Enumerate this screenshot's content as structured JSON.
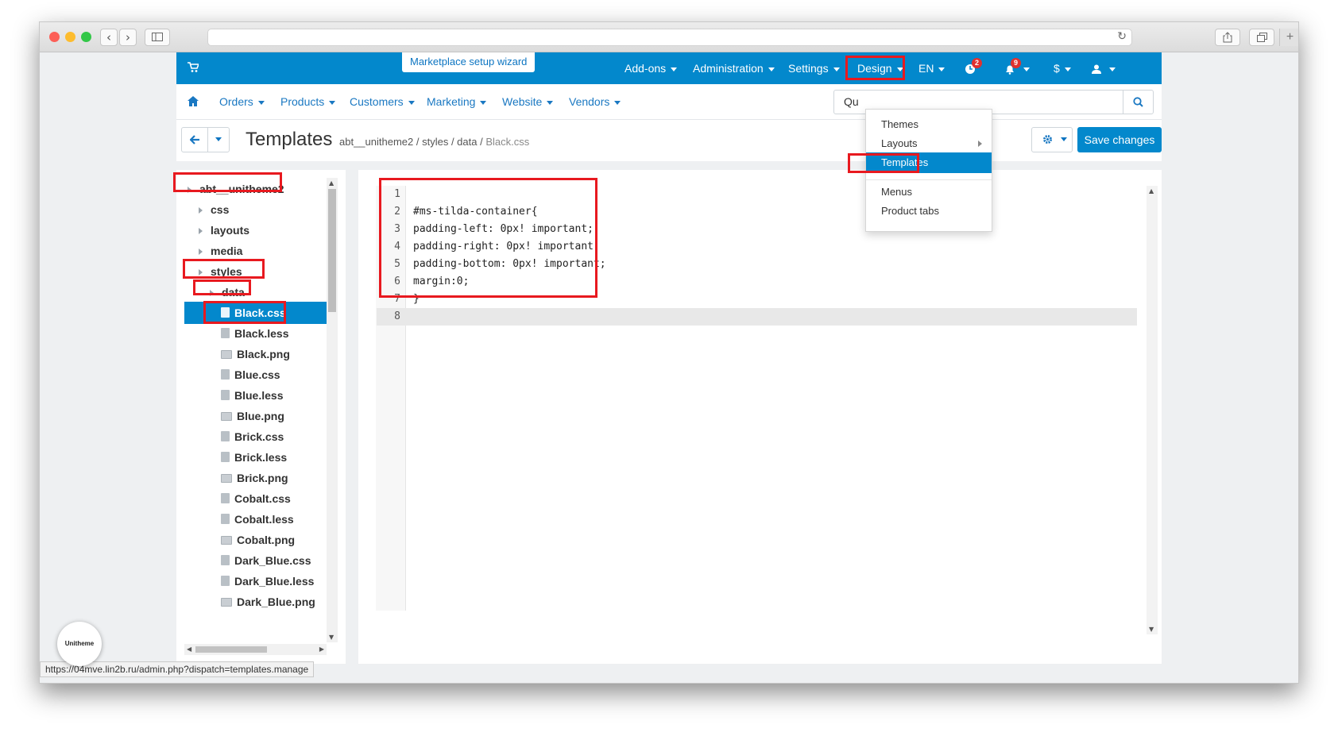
{
  "browser": {
    "status_url": "https://04mve.lin2b.ru/admin.php?dispatch=templates.manage"
  },
  "topbar": {
    "wizard_label": "Marketplace setup wizard",
    "nav": [
      "Add-ons",
      "Administration",
      "Settings",
      "Design",
      "EN"
    ],
    "updates_badge": "2",
    "notifications_badge": "9",
    "currency": "$"
  },
  "subnav": {
    "items": [
      "Orders",
      "Products",
      "Customers",
      "Marketing",
      "Website",
      "Vendors"
    ],
    "search_value": "Qu"
  },
  "titlebar": {
    "title": "Templates",
    "breadcrumbs": [
      "abt__unitheme2",
      "styles",
      "data",
      "Black.css"
    ],
    "save_label": "Save changes"
  },
  "tree": {
    "nodes": [
      {
        "label": "abt__unitheme2",
        "type": "folder"
      },
      {
        "label": "css",
        "type": "folder"
      },
      {
        "label": "layouts",
        "type": "folder"
      },
      {
        "label": "media",
        "type": "folder"
      },
      {
        "label": "styles",
        "type": "folder"
      },
      {
        "label": "data",
        "type": "folder"
      },
      {
        "label": "Black.css",
        "type": "file",
        "selected": true
      },
      {
        "label": "Black.less",
        "type": "file"
      },
      {
        "label": "Black.png",
        "type": "image"
      },
      {
        "label": "Blue.css",
        "type": "file"
      },
      {
        "label": "Blue.less",
        "type": "file"
      },
      {
        "label": "Blue.png",
        "type": "image"
      },
      {
        "label": "Brick.css",
        "type": "file"
      },
      {
        "label": "Brick.less",
        "type": "file"
      },
      {
        "label": "Brick.png",
        "type": "image"
      },
      {
        "label": "Cobalt.css",
        "type": "file"
      },
      {
        "label": "Cobalt.less",
        "type": "file"
      },
      {
        "label": "Cobalt.png",
        "type": "image"
      },
      {
        "label": "Dark_Blue.css",
        "type": "file"
      },
      {
        "label": "Dark_Blue.less",
        "type": "file"
      },
      {
        "label": "Dark_Blue.png",
        "type": "image"
      }
    ]
  },
  "editor": {
    "lines": [
      {
        "num": "1",
        "text": ""
      },
      {
        "num": "2",
        "text": "#ms-tilda-container{"
      },
      {
        "num": "3",
        "text": "padding-left: 0px! important;"
      },
      {
        "num": "4",
        "text": "padding-right: 0px! important;"
      },
      {
        "num": "5",
        "text": "padding-bottom: 0px! important;"
      },
      {
        "num": "6",
        "text": "margin:0;"
      },
      {
        "num": "7",
        "text": "}"
      },
      {
        "num": "8",
        "text": ""
      }
    ]
  },
  "design_menu": {
    "items": [
      "Themes",
      "Layouts",
      "Templates",
      "Menus",
      "Product tabs"
    ],
    "active": "Templates"
  },
  "unitheme_badge": "Unitheme",
  "colors": {
    "accent": "#0388cc",
    "highlight_box": "#e8191f"
  }
}
